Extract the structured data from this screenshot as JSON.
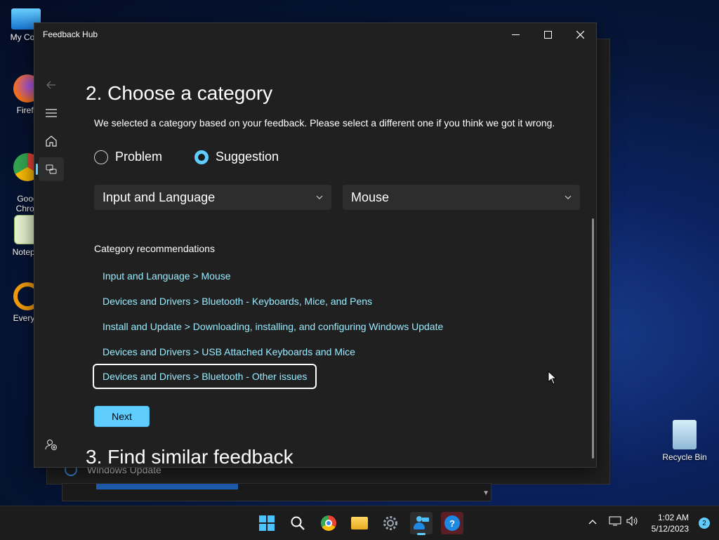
{
  "desktop": {
    "icons": [
      {
        "label": "My Com",
        "icon": "monitor-icon"
      },
      {
        "label": "Firefo",
        "icon": "firefox-icon"
      },
      {
        "label": "Goog\nChron",
        "icon": "chrome-icon"
      },
      {
        "label": "Notepa",
        "icon": "notepad-icon"
      },
      {
        "label": "Everyth",
        "icon": "search-icon"
      }
    ],
    "recycle_bin": "Recycle Bin"
  },
  "background_window": {
    "windows_update_label": "Windows Update"
  },
  "app": {
    "title": "Feedback Hub",
    "heading": "2. Choose a category",
    "subtitle": "We selected a category based on your feedback. Please select a different one if you think we got it wrong.",
    "radio_problem": "Problem",
    "radio_suggestion": "Suggestion",
    "selected_type": "Suggestion",
    "category_combo": "Input and Language",
    "subcategory_combo": "Mouse",
    "recommendations_heading": "Category recommendations",
    "recommendations": [
      "Input and Language > Mouse",
      "Devices and Drivers > Bluetooth - Keyboards, Mice, and Pens",
      "Install and Update > Downloading, installing, and configuring Windows Update",
      "Devices and Drivers > USB Attached Keyboards and Mice",
      "Devices and Drivers > Bluetooth - Other issues"
    ],
    "next_button": "Next",
    "next_heading": "3. Find similar feedback"
  },
  "taskbar": {
    "time": "1:02 AM",
    "date": "5/12/2023",
    "notification_count": "2"
  },
  "colors": {
    "accent": "#60cdff",
    "link": "#99ebff",
    "app_bg": "#202020"
  }
}
